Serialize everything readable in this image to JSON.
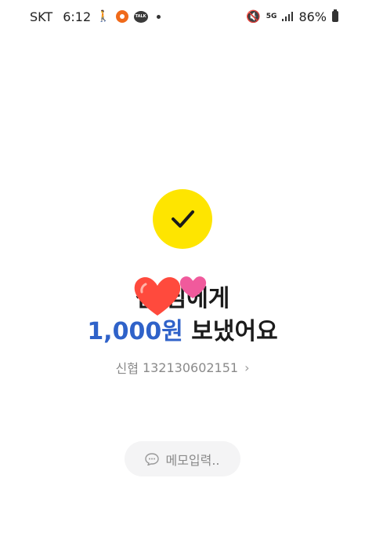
{
  "status_bar": {
    "carrier": "SKT",
    "time": "6:12",
    "network": "5G",
    "battery": "86%"
  },
  "result": {
    "recipient_line": "심 님에게",
    "amount": "1,000원",
    "sent_text": "보냈어요"
  },
  "account": {
    "bank": "신협",
    "number": "132130602151"
  },
  "memo": {
    "label": "메모입력.."
  },
  "colors": {
    "accent_yellow": "#fee500",
    "amount_blue": "#2f62c9",
    "memo_bg": "#f4f4f5"
  },
  "icons": [
    "walking-icon",
    "record-icon",
    "talk-icon",
    "mute-icon",
    "signal-icon",
    "battery-icon",
    "check-icon",
    "heart-sticker",
    "chevron-right-icon",
    "chat-bubble-icon"
  ]
}
